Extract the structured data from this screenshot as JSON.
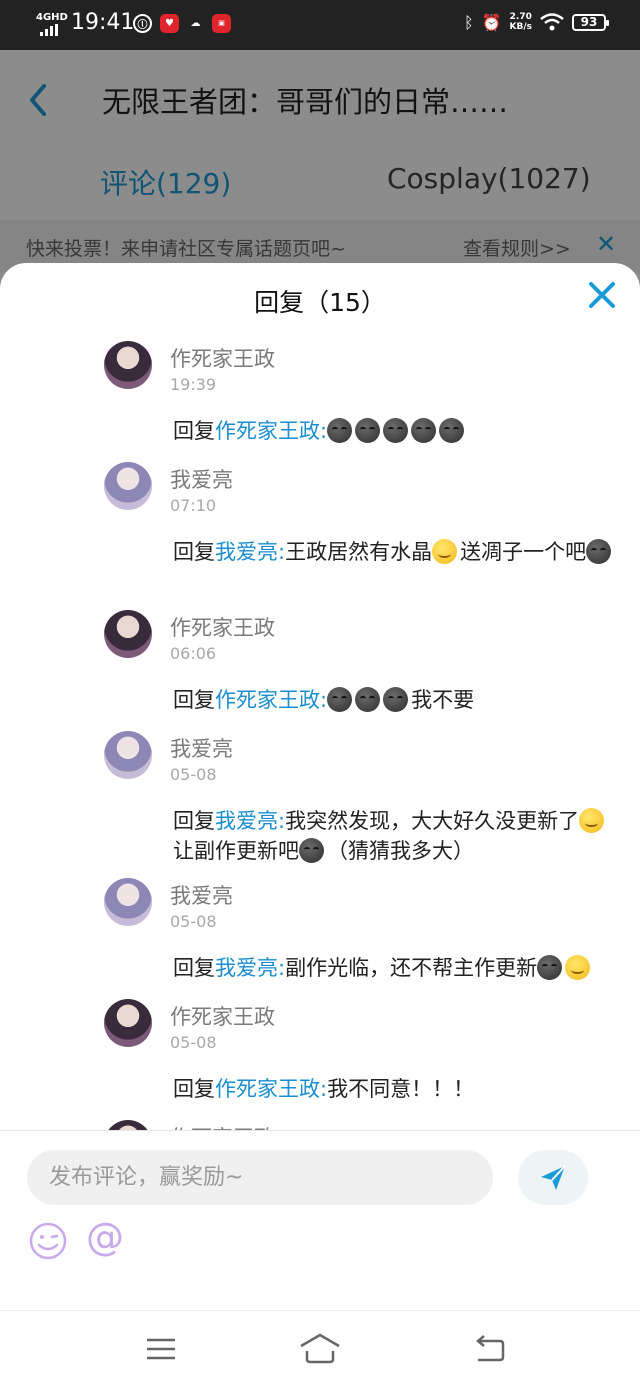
{
  "status_bar": {
    "network": "4GHD",
    "time": "19:41",
    "speed_value": "2.70",
    "speed_unit": "KB/s",
    "battery": "93"
  },
  "header": {
    "title": "无限王者团：哥哥们的日常……"
  },
  "tabs": [
    {
      "label": "评论(129)"
    },
    {
      "label": "Cosplay(1027)"
    }
  ],
  "notice": {
    "text": "快来投票！来申请社区专属话题页吧~",
    "link": "查看规则>>"
  },
  "sheet": {
    "title": "回复（15）",
    "reply_prefix": "回复",
    "comments": [
      {
        "user": "作死家王政",
        "time": "19:39",
        "reply_to": "作死家王政:",
        "text": ""
      },
      {
        "user": "我爱亮",
        "time": "07:10",
        "reply_to": "我爱亮:",
        "text": "王政居然有水晶"
      },
      {
        "user": "作死家王政",
        "time": "06:06",
        "reply_to": "作死家王政:",
        "text": "我不要"
      },
      {
        "user": "我爱亮",
        "time": "05-08",
        "reply_to": "我爱亮:",
        "text": "我突然发现，大大好久没更新了"
      },
      {
        "user": "我爱亮",
        "time": "05-08",
        "reply_to": "我爱亮:",
        "text": "副作光临，还不帮主作更新"
      },
      {
        "user": "作死家王政",
        "time": "05-08",
        "reply_to": "作死家王政:",
        "text": "我不同意！！！"
      },
      {
        "user": "作死家王政",
        "time": "",
        "reply_to": "",
        "text": ""
      }
    ],
    "extra": {
      "c2_mid": "送凋子一个吧",
      "c4_mid": "让副作更新吧",
      "c4_end": "（猜猜我多大）"
    }
  },
  "composer": {
    "placeholder": "发布评论，赢奖励~",
    "at_symbol": "@"
  },
  "colors": {
    "accent": "#1a9bd8",
    "link": "#1a8ed0",
    "overlay": "rgba(0,0,0,0.45)"
  }
}
